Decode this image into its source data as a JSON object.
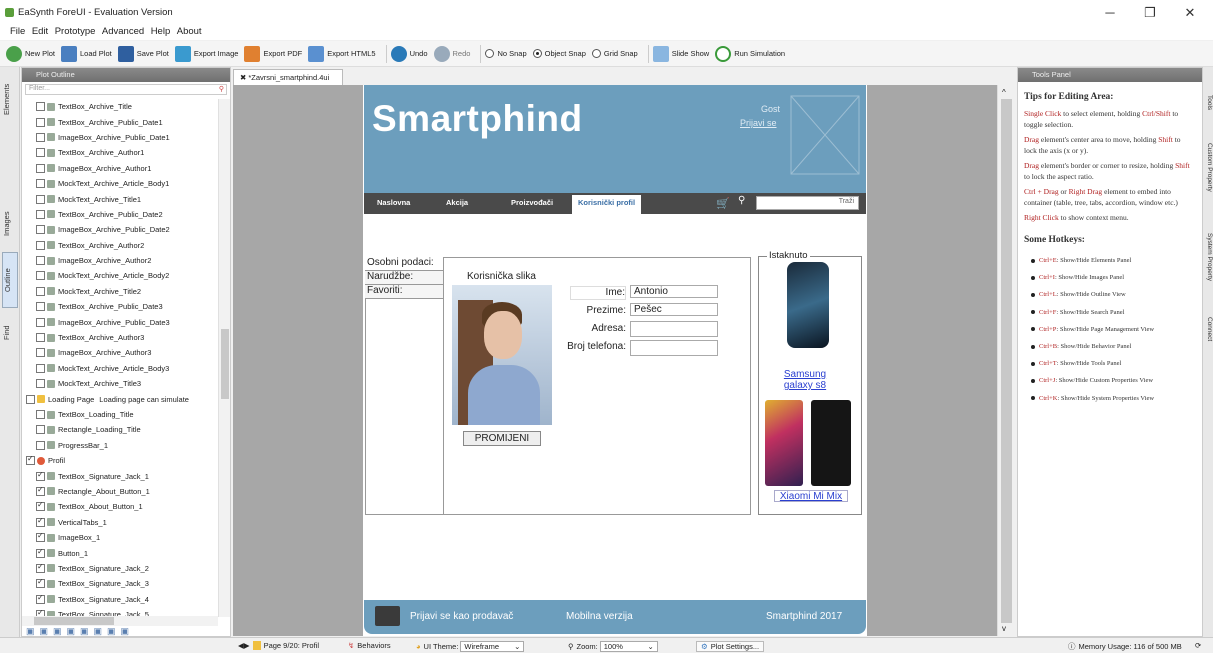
{
  "app": {
    "title": "EaSynth ForeUI - Evaluation Version",
    "menu": [
      "File",
      "Edit",
      "Prototype",
      "Advanced",
      "Help",
      "About"
    ]
  },
  "toolbar": {
    "new_plot": "New Plot",
    "load_plot": "Load Plot",
    "save_plot": "Save Plot",
    "export_image": "Export Image",
    "export_pdf": "Export PDF",
    "export_html5": "Export HTML5",
    "undo": "Undo",
    "redo": "Redo",
    "no_snap": "No Snap",
    "object_snap": "Object Snap",
    "grid_snap": "Grid Snap",
    "slide_show": "Slide Show",
    "run_simulation": "Run Simulation"
  },
  "left_tabs": [
    "Elements",
    "Images",
    "Outline",
    "Find"
  ],
  "outline": {
    "header": "Plot Outline",
    "filter_placeholder": "Filter...",
    "items": [
      {
        "label": "TextBox_Archive_Title",
        "checked": false
      },
      {
        "label": "TextBox_Archive_Public_Date1",
        "checked": false
      },
      {
        "label": "ImageBox_Archive_Public_Date1",
        "checked": false
      },
      {
        "label": "TextBox_Archive_Author1",
        "checked": false
      },
      {
        "label": "ImageBox_Archive_Author1",
        "checked": false
      },
      {
        "label": "MockText_Archive_Article_Body1",
        "checked": false
      },
      {
        "label": "MockText_Archive_Title1",
        "checked": false
      },
      {
        "label": "TextBox_Archive_Public_Date2",
        "checked": false
      },
      {
        "label": "ImageBox_Archive_Public_Date2",
        "checked": false
      },
      {
        "label": "TextBox_Archive_Author2",
        "checked": false
      },
      {
        "label": "ImageBox_Archive_Author2",
        "checked": false
      },
      {
        "label": "MockText_Archive_Article_Body2",
        "checked": false
      },
      {
        "label": "MockText_Archive_Title2",
        "checked": false
      },
      {
        "label": "TextBox_Archive_Public_Date3",
        "checked": false
      },
      {
        "label": "ImageBox_Archive_Public_Date3",
        "checked": false
      },
      {
        "label": "TextBox_Archive_Author3",
        "checked": false
      },
      {
        "label": "ImageBox_Archive_Author3",
        "checked": false
      },
      {
        "label": "MockText_Archive_Article_Body3",
        "checked": false
      },
      {
        "label": "MockText_Archive_Title3",
        "checked": false
      },
      {
        "label": "Loading Page",
        "checked": false,
        "page": true,
        "note": "Loading page can simulate"
      },
      {
        "label": "TextBox_Loading_Title",
        "checked": false
      },
      {
        "label": "Rectangle_Loading_Title",
        "checked": false
      },
      {
        "label": "ProgressBar_1",
        "checked": false
      },
      {
        "label": "Profil",
        "checked": true,
        "profile": true
      },
      {
        "label": "TextBox_Signature_Jack_1",
        "checked": true
      },
      {
        "label": "Rectangle_About_Button_1",
        "checked": true
      },
      {
        "label": "TextBox_About_Button_1",
        "checked": true
      },
      {
        "label": "VerticalTabs_1",
        "checked": true
      },
      {
        "label": "ImageBox_1",
        "checked": true
      },
      {
        "label": "Button_1",
        "checked": true
      },
      {
        "label": "TextBox_Signature_Jack_2",
        "checked": true
      },
      {
        "label": "TextBox_Signature_Jack_3",
        "checked": true
      },
      {
        "label": "TextBox_Signature_Jack_4",
        "checked": true
      },
      {
        "label": "TextBox_Signature_Jack_5",
        "checked": true
      }
    ]
  },
  "document_tab": "*Zavrsni_smartphind.4ui",
  "site": {
    "logo": "Smartphind",
    "guest": "Gost",
    "login_link": "Prijavi se",
    "nav": [
      "Naslovna",
      "Akcija",
      "Proizvođači",
      "Korisnički profil"
    ],
    "search_button": "Traži",
    "side_tabs": [
      "Osobni podaci:",
      "Narudžbe:",
      "Favoriti:"
    ],
    "user_image_label": "Korisnička slika",
    "change_button": "PROMIJENI",
    "fields": [
      {
        "label": "Ime:",
        "value": "Antonio"
      },
      {
        "label": "Prezime:",
        "value": "Pešec"
      },
      {
        "label": "Adresa:",
        "value": ""
      },
      {
        "label": "Broj telefona:",
        "value": ""
      }
    ],
    "featured": {
      "title": "Istaknuto",
      "product1": "Samsung galaxy s8",
      "product2": "Xiaomi Mi Mix"
    },
    "footer": {
      "seller_login": "Prijavi se kao prodavač",
      "mobile": "Mobilna verzija",
      "copyright": "Smartphind 2017"
    }
  },
  "tools_panel": {
    "header": "Tools Panel",
    "tips_title": "Tips for Editing Area:",
    "tips": [
      {
        "hl": "Single Click",
        "text": " to select element, holding "
      },
      {
        "hl": "Ctrl/Shift",
        "text": " to toggle selection."
      },
      {
        "hl": "Drag",
        "text": " element's center area to move, holding "
      },
      {
        "hl": "Shift",
        "text": " to lock the axis (x or y)."
      },
      {
        "hl": "Drag",
        "text": " element's border or corner to resize, holding "
      },
      {
        "hl": "Shift",
        "text": " to lock the aspect ratio."
      },
      {
        "hl": "Ctrl + Drag",
        "text": " or "
      },
      {
        "hl": "Right Drag",
        "text": " element to embed into container (table, tree, tabs, accordion, window etc.)"
      },
      {
        "hl": "Right Click",
        "text": " to show context menu."
      }
    ],
    "hotkeys_title": "Some Hotkeys:",
    "hotkeys": [
      {
        "key": "Ctrl+E",
        "desc": ": Show/Hide Elements Panel"
      },
      {
        "key": "Ctrl+I",
        "desc": ": Show/Hide Images Panel"
      },
      {
        "key": "Ctrl+L",
        "desc": ": Show/Hide Outline View"
      },
      {
        "key": "Ctrl+F",
        "desc": ": Show/Hide Search Panel"
      },
      {
        "key": "Ctrl+P",
        "desc": ": Show/Hide Page Management View"
      },
      {
        "key": "Ctrl+B",
        "desc": ": Show/Hide Behavior Panel"
      },
      {
        "key": "Ctrl+T",
        "desc": ": Show/Hide Tools Panel"
      },
      {
        "key": "Ctrl+J",
        "desc": ": Show/Hide Custom Properties View"
      },
      {
        "key": "Ctrl+K",
        "desc": ": Show/Hide System Properties View"
      }
    ]
  },
  "right_tabs": [
    "Tools",
    "Custom Property",
    "System Property",
    "Connect"
  ],
  "status": {
    "page": "Page 9/20: Profil",
    "behaviors": "Behaviors",
    "ui_theme_label": "UI Theme:",
    "ui_theme_value": "Wireframe",
    "zoom_label": "Zoom:",
    "zoom_value": "100%",
    "plot_settings": "Plot Settings...",
    "memory": "Memory Usage: 116 of 500 MB"
  },
  "colors": {
    "site_header": "#6c9ebd",
    "navbar": "#4a4a4a",
    "canvas": "#a7a7a7",
    "accent_red": "#b02020"
  }
}
